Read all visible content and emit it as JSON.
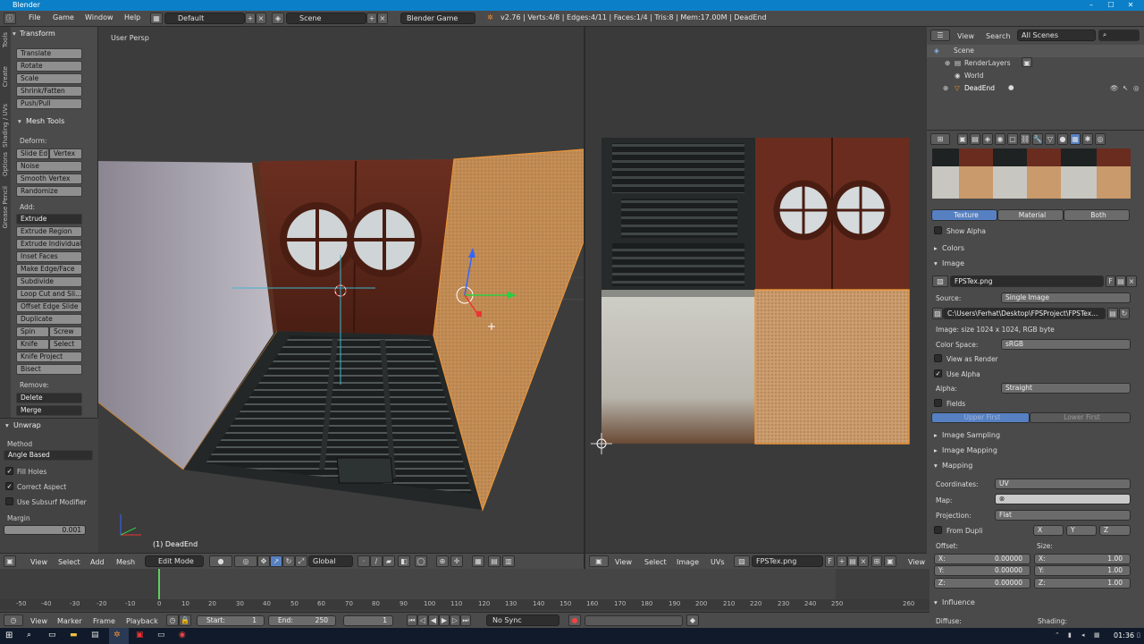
{
  "window": {
    "title": "Blender"
  },
  "topbar": {
    "menus": [
      "File",
      "Game",
      "Window",
      "Help"
    ],
    "layout": "Default",
    "scene": "Scene",
    "engine": "Blender Game",
    "stats": "v2.76 | Verts:4/8 | Edges:4/11 | Faces:1/4 | Tris:8 | Mem:17.00M | DeadEnd"
  },
  "toolshelf": {
    "tabs": [
      "Tools",
      "Create",
      "Shading / UVs",
      "Options",
      "Grease Pencil"
    ],
    "transform": {
      "title": "Transform",
      "items": [
        "Translate",
        "Rotate",
        "Scale",
        "Shrink/Fatten",
        "Push/Pull"
      ]
    },
    "mesh_tools": {
      "title": "Mesh Tools",
      "deform_label": "Deform:",
      "slide_edge": "Slide Ed",
      "vertex": "Vertex",
      "noise": "Noise",
      "smooth_vertex": "Smooth Vertex",
      "randomize": "Randomize",
      "add_label": "Add:",
      "extrude": "Extrude",
      "extrude_region": "Extrude Region",
      "extrude_individual": "Extrude Individual",
      "inset_faces": "Inset Faces",
      "make_edge_face": "Make Edge/Face",
      "subdivide": "Subdivide",
      "loop_cut": "Loop Cut and Sli...",
      "offset_edge": "Offset Edge Slide",
      "duplicate": "Duplicate",
      "spin": "Spin",
      "screw": "Screw",
      "knife": "Knife",
      "select": "Select",
      "knife_project": "Knife Project",
      "bisect": "Bisect",
      "remove_label": "Remove:",
      "delete": "Delete",
      "merge": "Merge"
    },
    "unwrap": {
      "title": "Unwrap",
      "method_label": "Method",
      "method": "Angle Based",
      "fill_holes": "Fill Holes",
      "correct_aspect": "Correct Aspect",
      "use_subsurf": "Use Subsurf Modifier",
      "margin_label": "Margin",
      "margin": "0.001"
    }
  },
  "view3d": {
    "label": "User Persp",
    "object": "(1) DeadEnd",
    "header": {
      "view": "View",
      "select": "Select",
      "add": "Add",
      "mesh": "Mesh",
      "mode": "Edit Mode",
      "orientation": "Global"
    }
  },
  "uv_editor": {
    "header": {
      "view": "View",
      "select": "Select",
      "image": "Image",
      "uvs": "UVs",
      "image_name": "FPSTex.png",
      "f": "F",
      "view2": "View"
    }
  },
  "outliner": {
    "view": "View",
    "search": "Search",
    "filter": "All Scenes",
    "items": [
      "Scene",
      "RenderLayers",
      "World",
      "DeadEnd"
    ]
  },
  "properties": {
    "tabs": [
      "Texture",
      "Material",
      "Both"
    ],
    "show_alpha": "Show Alpha",
    "colors": "Colors",
    "image_panel": "Image",
    "image_name": "FPSTex.png",
    "f": "F",
    "source_label": "Source:",
    "source": "Single Image",
    "path": "C:\\Users\\Ferhat\\Desktop\\FPSProject\\FPSTex...",
    "image_info": "Image: size 1024 x 1024, RGB byte",
    "color_space_label": "Color Space:",
    "color_space": "sRGB",
    "view_as_render": "View as Render",
    "use_alpha": "Use Alpha",
    "alpha_label": "Alpha:",
    "alpha": "Straight",
    "fields": "Fields",
    "upper_first": "Upper First",
    "lower_first": "Lower First",
    "image_sampling": "Image Sampling",
    "image_mapping": "Image Mapping",
    "mapping": "Mapping",
    "coordinates_label": "Coordinates:",
    "coordinates": "UV",
    "map_label": "Map:",
    "projection_label": "Projection:",
    "projection": "Flat",
    "from_dupli": "From Dupli",
    "axis_x": "X",
    "axis_y": "Y",
    "axis_z": "Z",
    "offset_label": "Offset:",
    "size_label": "Size:",
    "offset": [
      {
        "axis": "X:",
        "val": "0.00000"
      },
      {
        "axis": "Y:",
        "val": "0.00000"
      },
      {
        "axis": "Z:",
        "val": "0.00000"
      }
    ],
    "size": [
      {
        "axis": "X:",
        "val": "1.00"
      },
      {
        "axis": "Y:",
        "val": "1.00"
      },
      {
        "axis": "Z:",
        "val": "1.00"
      }
    ],
    "influence": "Influence",
    "diffuse_label": "Diffuse:",
    "shading_label": "Shading:"
  },
  "timeline": {
    "ticks": [
      "-50",
      "-40",
      "-30",
      "-20",
      "-10",
      "0",
      "10",
      "20",
      "30",
      "40",
      "50",
      "60",
      "70",
      "80",
      "90",
      "100",
      "110",
      "120",
      "130",
      "140",
      "150",
      "160",
      "170",
      "180",
      "190",
      "200",
      "210",
      "220",
      "230",
      "240",
      "250",
      "260"
    ],
    "header": {
      "view": "View",
      "marker": "Marker",
      "frame": "Frame",
      "playback": "Playback",
      "start_label": "Start:",
      "start": "1",
      "end_label": "End:",
      "end": "250",
      "current": "1",
      "sync": "No Sync"
    }
  },
  "taskbar": {
    "clock": "01:36"
  },
  "colors": {
    "accent": "#5680c2",
    "selection": "#e8953a",
    "titlebar": "#0b7fc7"
  }
}
